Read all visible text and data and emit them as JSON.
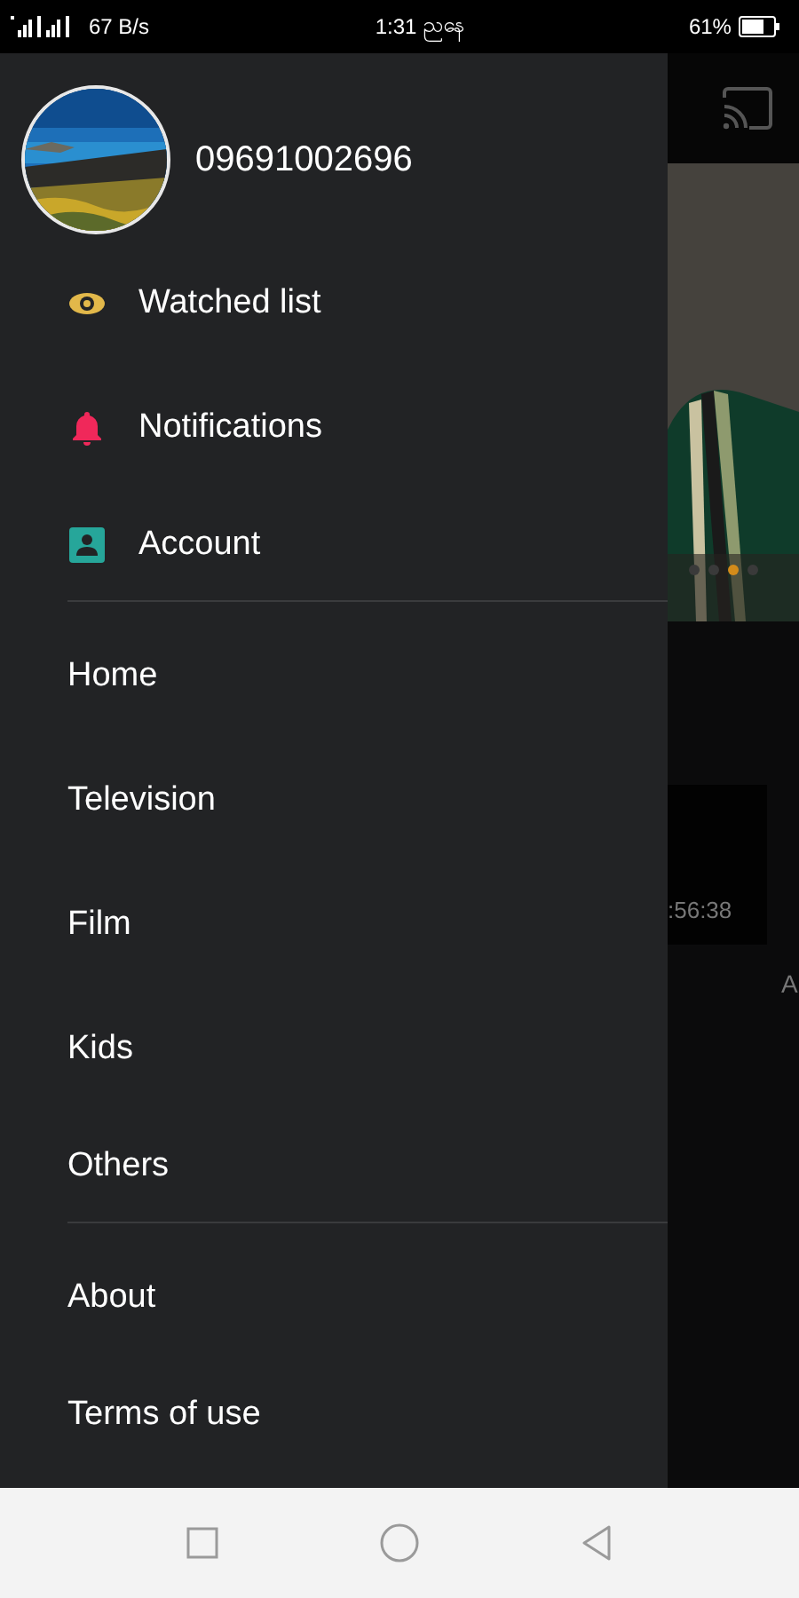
{
  "status_bar": {
    "speed": "67 B/s",
    "time": "1:31",
    "period": "ညနေ",
    "battery": "61%"
  },
  "background": {
    "dots": [
      {
        "selected": false
      },
      {
        "selected": false
      },
      {
        "selected": true
      },
      {
        "selected": false
      }
    ],
    "duration": ":56:38",
    "caption": "A"
  },
  "drawer": {
    "user": {
      "phone": "09691002696"
    },
    "groups": [
      [
        {
          "label": "Watched list",
          "kind": "eye"
        },
        {
          "label": "Notifications",
          "kind": "bell"
        },
        {
          "label": "Account",
          "kind": "account"
        }
      ],
      [
        {
          "label": "Home"
        },
        {
          "label": "Television"
        },
        {
          "label": "Film"
        },
        {
          "label": "Kids"
        },
        {
          "label": "Others"
        }
      ],
      [
        {
          "label": "About"
        },
        {
          "label": "Terms of use"
        }
      ]
    ]
  }
}
